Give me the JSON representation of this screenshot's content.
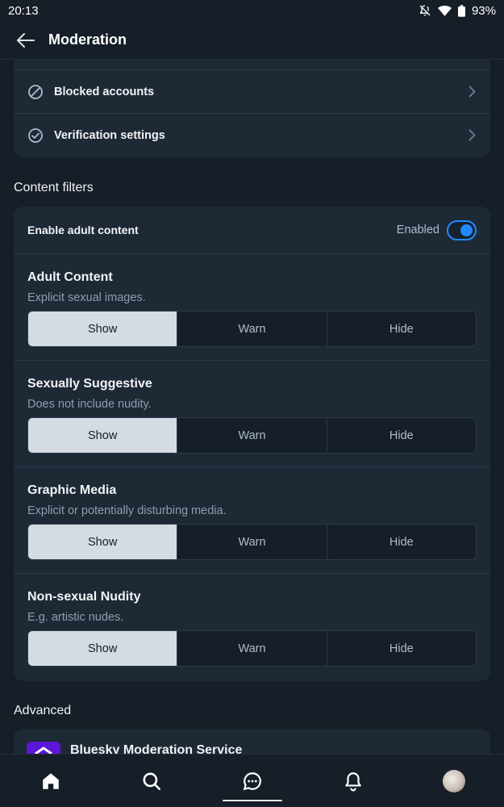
{
  "status_bar": {
    "time": "20:13",
    "battery": "93%"
  },
  "header": {
    "title": "Moderation"
  },
  "top_card": {
    "items": [
      {
        "label": "Blocked accounts",
        "icon": "block-icon"
      },
      {
        "label": "Verification settings",
        "icon": "check-circle-icon"
      }
    ]
  },
  "content_filters": {
    "title": "Content filters",
    "enable": {
      "label": "Enable adult content",
      "status": "Enabled",
      "on": true
    },
    "options": [
      "Show",
      "Warn",
      "Hide"
    ],
    "filters": [
      {
        "title": "Adult Content",
        "description": "Explicit sexual images.",
        "selected": "Show"
      },
      {
        "title": "Sexually Suggestive",
        "description": "Does not include nudity.",
        "selected": "Show"
      },
      {
        "title": "Graphic Media",
        "description": "Explicit or potentially disturbing media.",
        "selected": "Show"
      },
      {
        "title": "Non-sexual Nudity",
        "description": "E.g. artistic nudes.",
        "selected": "Show"
      }
    ]
  },
  "advanced": {
    "title": "Advanced",
    "service": {
      "name": "Bluesky Moderation Service"
    }
  },
  "bottom_nav": {
    "tabs": [
      "home-icon",
      "search-icon",
      "chat-icon",
      "bell-icon",
      "avatar"
    ],
    "active": "chat-icon"
  },
  "colors": {
    "accent": "#208bfe",
    "background": "#161e27",
    "card": "#1e2936",
    "service_logo": "#5b16d8"
  }
}
